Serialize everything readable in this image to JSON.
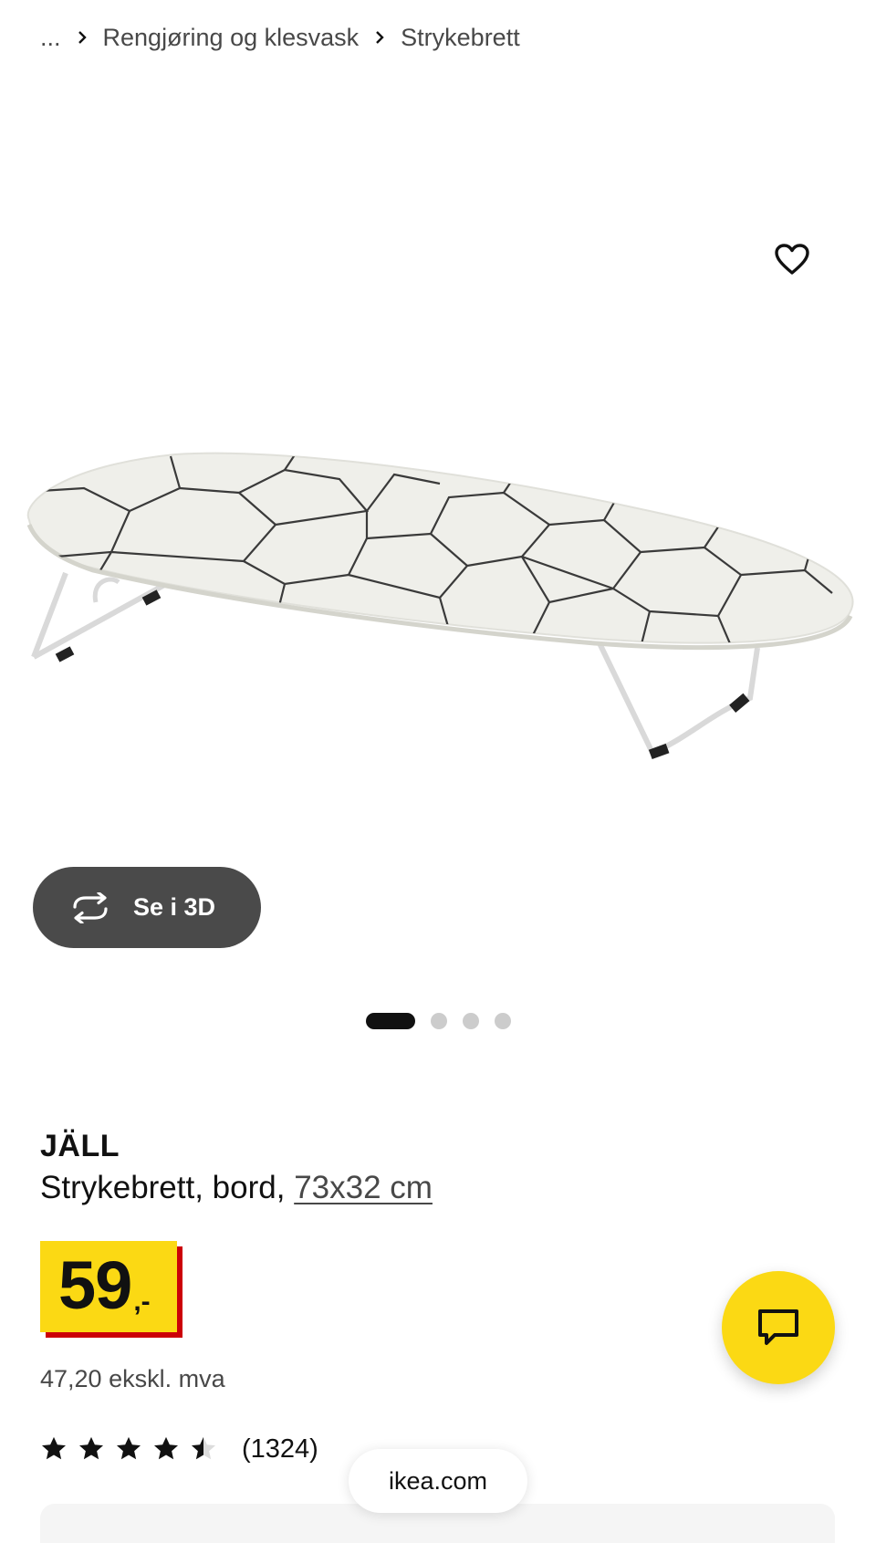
{
  "breadcrumb": {
    "ellipsis": "...",
    "items": [
      "Rengjøring og klesvask",
      "Strykebrett"
    ]
  },
  "gallery": {
    "view_3d_label": "Se i 3D",
    "image_count": 4,
    "active_image": 1
  },
  "product": {
    "name": "JÄLL",
    "description": "Strykebrett, bord,",
    "size": "73x32 cm",
    "price_integer": "59",
    "price_suffix": ",-",
    "price_ex_vat": "47,20 ekskl. mva",
    "rating_value": 4.5,
    "rating_count": "(1324)"
  },
  "browser": {
    "url": "ikea.com"
  },
  "colors": {
    "price_yellow": "#fbd914",
    "price_red": "#cc0008",
    "button_dark": "#4a4a4a"
  }
}
